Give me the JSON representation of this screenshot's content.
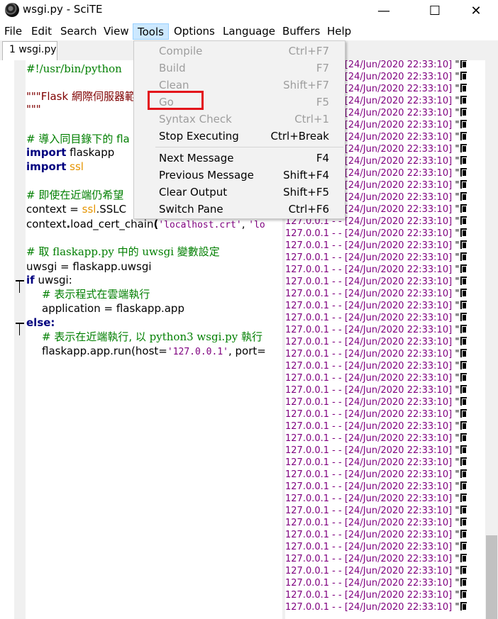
{
  "window": {
    "title": "wsgi.py - SciTE",
    "minimize": "—",
    "maximize": "☐",
    "close": "✕"
  },
  "menubar": [
    "File",
    "Edit",
    "Search",
    "View",
    "Tools",
    "Options",
    "Language",
    "Buffers",
    "Help"
  ],
  "active_menu": "Tools",
  "tab": {
    "label": "1 wsgi.py"
  },
  "editor": {
    "lines": {
      "shebang": "#!/usr/bin/python",
      "docstring_open": "\"\"\"Flask 網際伺服器範",
      "docstring_close": "\"\"\"",
      "comment_import": "# 導入同目錄下的 fla",
      "import1_kw": "import",
      "import1_mod": " flaskapp",
      "import2_kw": "import",
      "import2_mod": " ssl",
      "comment_context": "# 即使在近端仍希望",
      "context_a": "context = ",
      "context_b": "ssl",
      "context_c": ".SSLC",
      "load_a": "context",
      "load_b": ".",
      "load_c": "load_cert_chain",
      "load_d": "(",
      "load_e": "'localhost.crt'",
      "load_f": ", ",
      "load_g": "'lo",
      "comment_uwsgi_a": "# 取 ",
      "comment_uwsgi_b": "flaskapp.py",
      "comment_uwsgi_c": " 中的 ",
      "comment_uwsgi_d": "uwsgi",
      "comment_uwsgi_e": " 變數設定",
      "uwsgi_assign": "uwsgi = flaskapp.uwsgi",
      "if_kw": "if",
      "if_rest": " uwsgi:",
      "comment_cloud": "# 表示程式在雲端執行",
      "application": "application = flaskapp.app",
      "else_kw": "else:",
      "comment_local_a": "# 表示在近端執行, 以 ",
      "comment_local_b": "python3 wsgi.py",
      "comment_local_c": " 執行",
      "run_a": "flaskapp.app.run(host=",
      "run_b": "'127.0.0.1'",
      "run_c": ", port="
    }
  },
  "output": {
    "ip": "127.0.0.1 - -",
    "timestamp": "[24/Jun/2020 22:33:10]",
    "quote": "\"",
    "line_count": 46
  },
  "tools_menu": {
    "items": [
      {
        "label": "Compile",
        "shortcut": "Ctrl+F7",
        "enabled": false
      },
      {
        "label": "Build",
        "shortcut": "F7",
        "enabled": false
      },
      {
        "label": "Clean",
        "shortcut": "Shift+F7",
        "enabled": false
      },
      {
        "label": "Go",
        "shortcut": "F5",
        "enabled": false
      },
      {
        "label": "Syntax Check",
        "shortcut": "Ctrl+1",
        "enabled": false
      },
      {
        "label": "Stop Executing",
        "shortcut": "Ctrl+Break",
        "enabled": true
      },
      {
        "label": "Next Message",
        "shortcut": "F4",
        "enabled": true
      },
      {
        "label": "Previous Message",
        "shortcut": "Shift+F4",
        "enabled": true
      },
      {
        "label": "Clear Output",
        "shortcut": "Shift+F5",
        "enabled": true
      },
      {
        "label": "Switch Pane",
        "shortcut": "Ctrl+F6",
        "enabled": true
      }
    ],
    "highlighted": "Go"
  },
  "colors": {
    "keyword": "#00007f",
    "comment": "#007f00",
    "string_single": "#7f007f",
    "string_triple": "#7f0000",
    "module_ssl": "#e59400",
    "output_text": "#7f007f",
    "highlight_box": "#e3121a"
  }
}
